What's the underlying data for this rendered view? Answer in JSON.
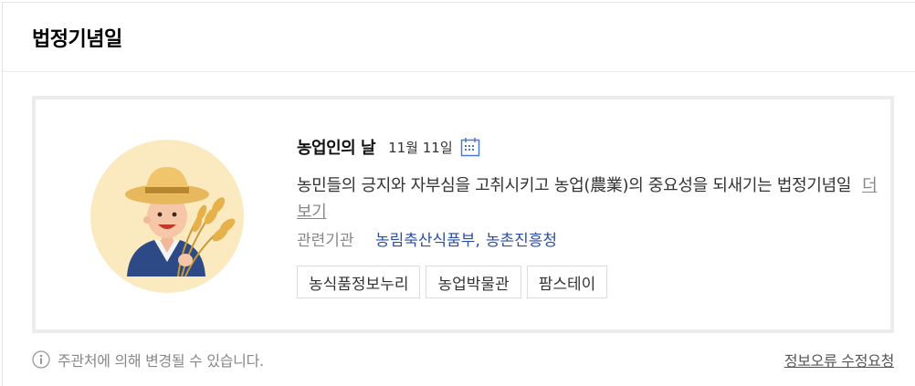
{
  "section": {
    "title": "법정기념일"
  },
  "event": {
    "name": "농업인의 날",
    "date": "11월 11일",
    "description": "농민들의 긍지와 자부심을 고취시키고 농업(農業)의 중요성을 되새기는 법정기념일",
    "more_label": "더보기",
    "org_label": "관련기관",
    "orgs": [
      "농림축산식품부",
      "농촌진흥청"
    ],
    "org_separator": ",",
    "related_links": [
      "농식품정보누리",
      "농업박물관",
      "팜스테이"
    ],
    "icons": {
      "calendar": "calendar-icon",
      "illustration": "farmer-illustration"
    }
  },
  "footer": {
    "notice": "주관처에 의해 변경될 수 있습니다.",
    "report_label": "정보오류 수정요청",
    "icon": "info-icon"
  },
  "colors": {
    "link": "#2a4fa5",
    "icon_accent": "#4a7ad6",
    "illustration_bg": "#fbe9bf"
  }
}
